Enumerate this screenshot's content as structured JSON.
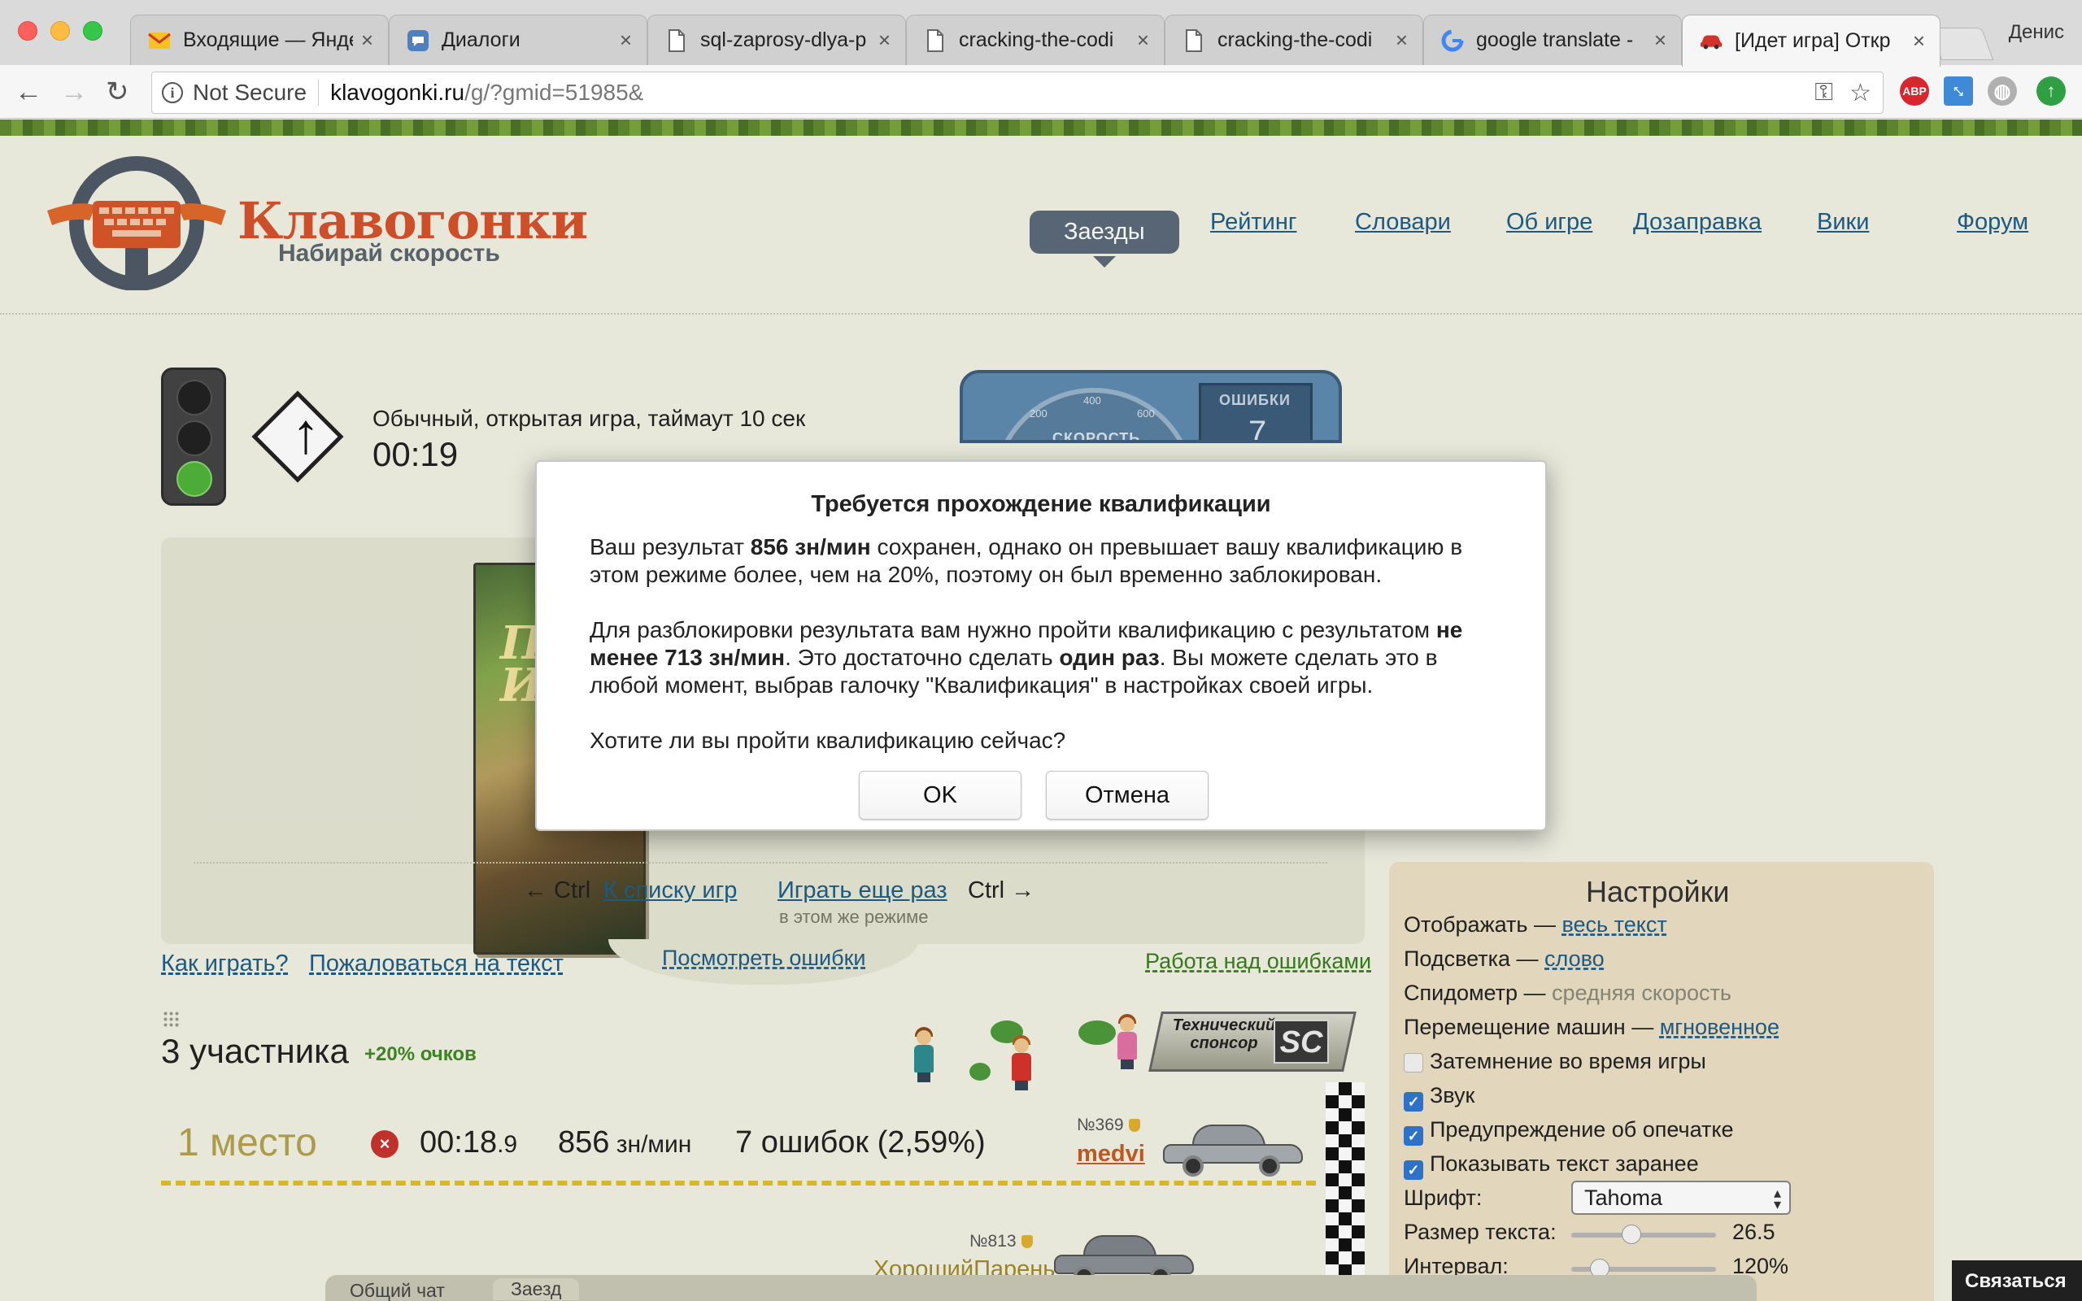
{
  "browser": {
    "tabs": [
      {
        "title": "Входящие — Янде",
        "icon": "yandex-mail-icon"
      },
      {
        "title": "Диалоги",
        "icon": "vk-messages-icon"
      },
      {
        "title": "sql-zaprosy-dlya-p",
        "icon": "document-icon"
      },
      {
        "title": "cracking-the-codi",
        "icon": "document-icon"
      },
      {
        "title": "cracking-the-codi",
        "icon": "document-icon"
      },
      {
        "title": "google translate -",
        "icon": "google-icon"
      },
      {
        "title": "[Идет игра] Откр",
        "icon": "car-icon"
      }
    ],
    "active_tab": 6,
    "profile_name": "Денис",
    "security_label": "Not Secure",
    "url_host": "klavogonki.ru",
    "url_path": "/g/?gmid=51985&"
  },
  "site": {
    "logo_name": "Клавогонки",
    "logo_tagline": "Набирай скорость",
    "nav": [
      "Заезды",
      "Рейтинг",
      "Словари",
      "Об игре",
      "Дозаправка",
      "Вики",
      "Форум"
    ],
    "nav_active": "Заезды"
  },
  "game": {
    "description": "Обычный, открытая игра, таймаут 10 сек",
    "timer": "00:19",
    "speedo_label": "СКОРОСТЬ",
    "speedo_ticks": [
      "200",
      "400",
      "600"
    ],
    "errors_label": "ОШИБКИ",
    "errors_value": "7",
    "book_title": "Пл Иза",
    "ctrl_left": "← Ctrl",
    "back_link": "К списку игр",
    "again_link": "Играть еще раз",
    "ctrl_right": "Ctrl →",
    "same_mode": "в этом же режиме",
    "how_to_play": "Как играть?",
    "complain": "Пожаловаться на текст",
    "view_errors": "Посмотреть ошибки",
    "work_on_errors": "Работа над ошибками",
    "participants": "3 участника",
    "bonus": "+20% очков",
    "sponsor_text": "Технический спонсор",
    "sponsor_logo": "SC"
  },
  "results": {
    "place": "1 место",
    "time_main": "00:18",
    "time_frac": ".9",
    "speed_value": "856",
    "speed_unit": " зн/мин",
    "errors": "7 ошибок (2,59%)",
    "players": [
      {
        "num": "№369",
        "name": "medvi"
      },
      {
        "num": "№813",
        "name": "ХорошийПарень"
      }
    ]
  },
  "settings": {
    "title": "Настройки",
    "display_label": "Отображать — ",
    "display_value": "весь текст",
    "highlight_label": "Подсветка — ",
    "highlight_value": "слово",
    "speedometer_label": "Спидометр — ",
    "speedometer_value": "средняя скорость",
    "car_move_label": "Перемещение машин — ",
    "car_move_value": "мгновенное",
    "checkboxes": [
      {
        "label": "Затемнение во время игры",
        "checked": false
      },
      {
        "label": "Звук",
        "checked": true
      },
      {
        "label": "Предупреждение об опечатке",
        "checked": true
      },
      {
        "label": "Показывать текст заранее",
        "checked": true
      }
    ],
    "font_label": "Шрифт:",
    "font_value": "Tahoma",
    "text_size_label": "Размер текста:",
    "text_size_value": "26.5",
    "text_size_level": 0.4,
    "interval_label": "Интервал:",
    "interval_value": "120%",
    "interval_level": 0.15
  },
  "chat": {
    "tabs": [
      "Общий чат",
      "Заезд"
    ],
    "contact_label": "Связаться"
  },
  "dialog": {
    "title": "Требуется прохождение квалификации",
    "p1_a": "Ваш результат ",
    "p1_b": "856 зн/мин",
    "p1_c": " сохранен, однако он превышает вашу квалификацию в этом режиме более, чем на 20%, поэтому он был временно заблокирован.",
    "p2_a": "Для разблокировки результата вам нужно пройти квалификацию с результатом ",
    "p2_b": "не менее 713 зн/мин",
    "p2_c": ". Это достаточно сделать ",
    "p2_d": "один раз",
    "p2_e": ". Вы можете сделать это в любой момент, выбрав галочку \"Квалификация\" в настройках своей игры.",
    "p3": "Хотите ли вы пройти квалификацию сейчас?",
    "ok_label": "OK",
    "cancel_label": "Отмена"
  }
}
